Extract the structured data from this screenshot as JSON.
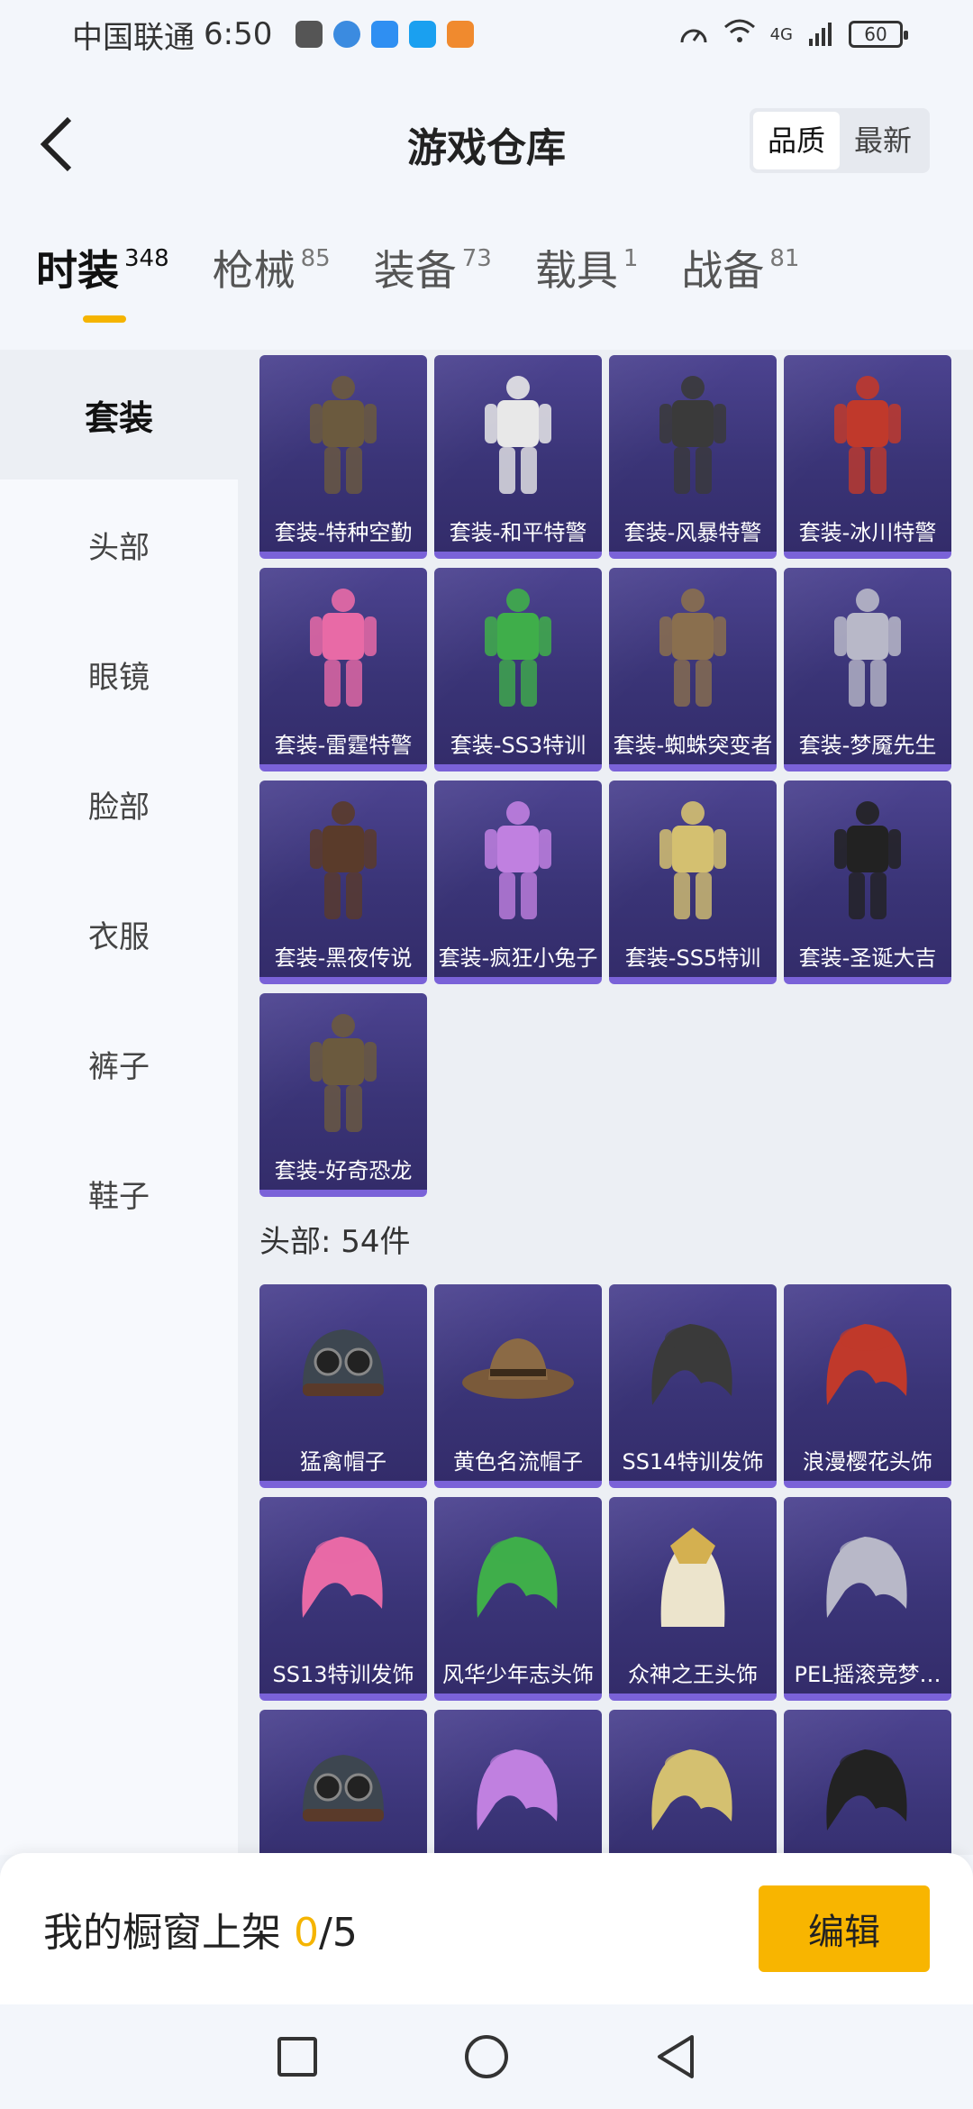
{
  "status_bar": {
    "carrier": "中国联通",
    "time": "6:50",
    "network": "4G",
    "battery": "60"
  },
  "header": {
    "title": "游戏仓库",
    "sort_options": [
      {
        "label": "品质",
        "active": true
      },
      {
        "label": "最新",
        "active": false
      }
    ]
  },
  "category_tabs": [
    {
      "label": "时装",
      "count": "348",
      "active": true
    },
    {
      "label": "枪械",
      "count": "85"
    },
    {
      "label": "装备",
      "count": "73"
    },
    {
      "label": "载具",
      "count": "1"
    },
    {
      "label": "战备",
      "count": "81"
    }
  ],
  "side_menu": [
    {
      "label": "套装",
      "active": true
    },
    {
      "label": "头部"
    },
    {
      "label": "眼镜"
    },
    {
      "label": "脸部"
    },
    {
      "label": "衣服"
    },
    {
      "label": "裤子"
    },
    {
      "label": "鞋子"
    }
  ],
  "sets": [
    {
      "label": "套装-特种空勤",
      "icon": "outfit-icon"
    },
    {
      "label": "套装-和平特警",
      "icon": "outfit-icon"
    },
    {
      "label": "套装-风暴特警",
      "icon": "outfit-icon"
    },
    {
      "label": "套装-冰川特警",
      "icon": "outfit-icon"
    },
    {
      "label": "套装-雷霆特警",
      "icon": "outfit-icon"
    },
    {
      "label": "套装-SS3特训",
      "icon": "outfit-icon"
    },
    {
      "label": "套装-蜘蛛突变者",
      "icon": "outfit-icon"
    },
    {
      "label": "套装-梦魇先生",
      "icon": "outfit-icon"
    },
    {
      "label": "套装-黑夜传说",
      "icon": "outfit-icon"
    },
    {
      "label": "套装-疯狂小兔子",
      "icon": "outfit-icon"
    },
    {
      "label": "套装-SS5特训",
      "icon": "outfit-icon"
    },
    {
      "label": "套装-圣诞大吉",
      "icon": "outfit-icon"
    },
    {
      "label": "套装-好奇恐龙",
      "icon": "outfit-icon"
    }
  ],
  "head_section": {
    "title": "头部: 54件",
    "items": [
      {
        "label": "猛禽帽子",
        "icon": "helmet-icon"
      },
      {
        "label": "黄色名流帽子",
        "icon": "hat-icon"
      },
      {
        "label": "SS14特训发饰",
        "icon": "hair-icon"
      },
      {
        "label": "浪漫樱花头饰",
        "icon": "hair-icon"
      },
      {
        "label": "SS13特训发饰",
        "icon": "hair-icon"
      },
      {
        "label": "风华少年志头饰",
        "icon": "hair-icon"
      },
      {
        "label": "众神之王头饰",
        "icon": "headdress-icon"
      },
      {
        "label": "PEL摇滚竞梦…",
        "icon": "hair-icon"
      },
      {
        "label": "",
        "icon": "cap-icon"
      },
      {
        "label": "",
        "icon": "hair-icon"
      },
      {
        "label": "",
        "icon": "hair-icon"
      },
      {
        "label": "",
        "icon": "hair-icon"
      }
    ]
  },
  "showcase": {
    "label": "我的橱窗上架",
    "current": "0",
    "total": "/5",
    "edit_label": "编辑"
  },
  "colors": {
    "accent": "#f5b400",
    "card_bg": "#3a3477",
    "card_border": "#7a62d8"
  }
}
